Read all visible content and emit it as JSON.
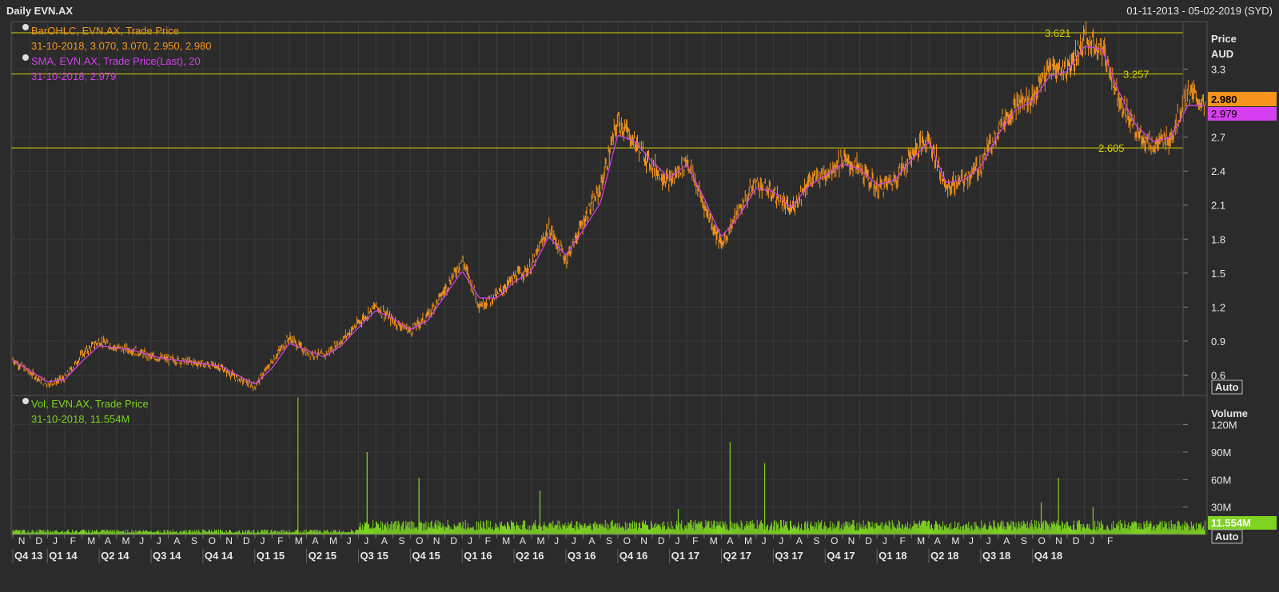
{
  "header": {
    "title": "Daily EVN.AX",
    "date_range": "01-11-2013 - 05-02-2019 (SYD)"
  },
  "colors": {
    "background": "#2b2b2b",
    "panel_border": "#555555",
    "grid": "#3b3b3b",
    "price_bars": "#f7941d",
    "sma": "#d63ff0",
    "volume": "#7ed321",
    "horizontal_lines": "#d4d400",
    "axis_text": "#e6e6e6"
  },
  "price_panel": {
    "legend": [
      {
        "icon": "radio-icon",
        "title": "BarOHLC, EVN.AX, Trade Price",
        "values": "31-10-2018, 3.070, 3.070, 2.950, 2.980"
      },
      {
        "icon": "radio-icon",
        "title": "SMA, EVN.AX, Trade Price(Last),  20",
        "values": "31-10-2018, 2.979"
      }
    ],
    "axis_title": "Price",
    "axis_unit": "AUD",
    "auto_label": "Auto",
    "last_price_tag": "2.980",
    "sma_tag": "2.979"
  },
  "volume_panel": {
    "legend": [
      {
        "icon": "radio-icon",
        "title": "Vol, EVN.AX, Trade Price",
        "values": "31-10-2018, 11.554M"
      }
    ],
    "axis_title": "Volume",
    "auto_label": "Auto",
    "last_volume_tag": "11.554M"
  },
  "chart_data": [
    {
      "type": "ohlc",
      "title": "Daily EVN.AX",
      "ylabel": "Price AUD",
      "ylim": [
        0.42,
        3.72
      ],
      "y_ticks": [
        "0.6",
        "0.9",
        "1.2",
        "1.5",
        "1.8",
        "2.1",
        "2.4",
        "2.7",
        "3.3"
      ],
      "y_tick_values": [
        0.6,
        0.9,
        1.2,
        1.5,
        1.8,
        2.1,
        2.4,
        2.7,
        3.3
      ],
      "x_range": [
        "2013-11",
        "2019-02"
      ],
      "horizontal_lines": [
        {
          "value": 3.621,
          "label": "3.621"
        },
        {
          "value": 3.257,
          "label": "3.257"
        },
        {
          "value": 2.605,
          "label": "2.605"
        }
      ],
      "series": [
        {
          "name": "BarOHLC, EVN.AX, Trade Price",
          "points": [
            [
              "2013-11",
              0.74
            ],
            [
              "2013-12",
              0.62
            ],
            [
              "2014-01",
              0.52
            ],
            [
              "2014-02",
              0.57
            ],
            [
              "2014-03",
              0.78
            ],
            [
              "2014-04",
              0.9
            ],
            [
              "2014-05",
              0.84
            ],
            [
              "2014-06",
              0.82
            ],
            [
              "2014-07",
              0.76
            ],
            [
              "2014-08",
              0.74
            ],
            [
              "2014-09",
              0.72
            ],
            [
              "2014-10",
              0.7
            ],
            [
              "2014-11",
              0.67
            ],
            [
              "2014-12",
              0.57
            ],
            [
              "2015-01",
              0.5
            ],
            [
              "2015-02",
              0.72
            ],
            [
              "2015-03",
              0.93
            ],
            [
              "2015-04",
              0.8
            ],
            [
              "2015-05",
              0.77
            ],
            [
              "2015-06",
              0.9
            ],
            [
              "2015-07",
              1.06
            ],
            [
              "2015-08",
              1.21
            ],
            [
              "2015-09",
              1.08
            ],
            [
              "2015-10",
              0.99
            ],
            [
              "2015-11",
              1.12
            ],
            [
              "2015-12",
              1.35
            ],
            [
              "2016-01",
              1.62
            ],
            [
              "2016-02",
              1.22
            ],
            [
              "2016-03",
              1.3
            ],
            [
              "2016-04",
              1.46
            ],
            [
              "2016-05",
              1.55
            ],
            [
              "2016-06",
              1.9
            ],
            [
              "2016-07",
              1.62
            ],
            [
              "2016-08",
              1.95
            ],
            [
              "2016-09",
              2.25
            ],
            [
              "2016-10",
              2.85
            ],
            [
              "2016-11",
              2.65
            ],
            [
              "2016-12",
              2.45
            ],
            [
              "2017-01",
              2.3
            ],
            [
              "2017-02",
              2.5
            ],
            [
              "2017-03",
              2.1
            ],
            [
              "2017-04",
              1.75
            ],
            [
              "2017-05",
              2.05
            ],
            [
              "2017-06",
              2.3
            ],
            [
              "2017-07",
              2.2
            ],
            [
              "2017-08",
              2.05
            ],
            [
              "2017-09",
              2.3
            ],
            [
              "2017-10",
              2.38
            ],
            [
              "2017-11",
              2.5
            ],
            [
              "2017-12",
              2.42
            ],
            [
              "2018-01",
              2.25
            ],
            [
              "2018-02",
              2.32
            ],
            [
              "2018-03",
              2.55
            ],
            [
              "2018-04",
              2.7
            ],
            [
              "2018-05",
              2.25
            ],
            [
              "2018-06",
              2.32
            ],
            [
              "2018-07",
              2.45
            ],
            [
              "2018-08",
              2.78
            ],
            [
              "2018-09",
              2.98
            ],
            [
              "2018-10",
              3.05
            ],
            [
              "2018-11",
              3.3
            ],
            [
              "2018-12",
              3.3
            ],
            [
              "2019-01",
              3.55
            ],
            [
              "2019-02",
              3.5
            ],
            [
              "2019-03",
              3.05
            ],
            [
              "2019-04",
              2.75
            ],
            [
              "2019-05",
              2.62
            ],
            [
              "2019-06",
              2.7
            ],
            [
              "2019-07",
              3.1
            ],
            [
              "2019-08",
              2.98
            ]
          ]
        },
        {
          "name": "SMA, EVN.AX, Trade Price(Last),  20",
          "points": [
            [
              "2013-11",
              0.73
            ],
            [
              "2013-12",
              0.64
            ],
            [
              "2014-01",
              0.54
            ],
            [
              "2014-02",
              0.56
            ],
            [
              "2014-03",
              0.72
            ],
            [
              "2014-04",
              0.86
            ],
            [
              "2014-05",
              0.84
            ],
            [
              "2014-06",
              0.82
            ],
            [
              "2014-07",
              0.77
            ],
            [
              "2014-08",
              0.74
            ],
            [
              "2014-09",
              0.72
            ],
            [
              "2014-10",
              0.7
            ],
            [
              "2014-11",
              0.68
            ],
            [
              "2014-12",
              0.6
            ],
            [
              "2015-01",
              0.52
            ],
            [
              "2015-02",
              0.66
            ],
            [
              "2015-03",
              0.88
            ],
            [
              "2015-04",
              0.82
            ],
            [
              "2015-05",
              0.76
            ],
            [
              "2015-06",
              0.86
            ],
            [
              "2015-07",
              1.02
            ],
            [
              "2015-08",
              1.17
            ],
            [
              "2015-09",
              1.1
            ],
            [
              "2015-10",
              1.0
            ],
            [
              "2015-11",
              1.08
            ],
            [
              "2015-12",
              1.3
            ],
            [
              "2016-01",
              1.52
            ],
            [
              "2016-02",
              1.28
            ],
            [
              "2016-03",
              1.28
            ],
            [
              "2016-04",
              1.42
            ],
            [
              "2016-05",
              1.52
            ],
            [
              "2016-06",
              1.82
            ],
            [
              "2016-07",
              1.66
            ],
            [
              "2016-08",
              1.88
            ],
            [
              "2016-09",
              2.12
            ],
            [
              "2016-10",
              2.72
            ],
            [
              "2016-11",
              2.66
            ],
            [
              "2016-12",
              2.48
            ],
            [
              "2017-01",
              2.34
            ],
            [
              "2017-02",
              2.46
            ],
            [
              "2017-03",
              2.16
            ],
            [
              "2017-04",
              1.82
            ],
            [
              "2017-05",
              2.0
            ],
            [
              "2017-06",
              2.25
            ],
            [
              "2017-07",
              2.22
            ],
            [
              "2017-08",
              2.08
            ],
            [
              "2017-09",
              2.26
            ],
            [
              "2017-10",
              2.36
            ],
            [
              "2017-11",
              2.46
            ],
            [
              "2017-12",
              2.42
            ],
            [
              "2018-01",
              2.28
            ],
            [
              "2018-02",
              2.32
            ],
            [
              "2018-03",
              2.5
            ],
            [
              "2018-04",
              2.66
            ],
            [
              "2018-05",
              2.3
            ],
            [
              "2018-06",
              2.32
            ],
            [
              "2018-07",
              2.44
            ],
            [
              "2018-08",
              2.72
            ],
            [
              "2018-09",
              2.94
            ],
            [
              "2018-10",
              3.02
            ],
            [
              "2018-11",
              3.24
            ],
            [
              "2018-12",
              3.28
            ],
            [
              "2019-01",
              3.5
            ],
            [
              "2019-02",
              3.48
            ],
            [
              "2019-03",
              3.1
            ],
            [
              "2019-04",
              2.8
            ],
            [
              "2019-05",
              2.66
            ],
            [
              "2019-06",
              2.7
            ],
            [
              "2019-07",
              2.98
            ],
            [
              "2019-08",
              2.979
            ]
          ]
        }
      ]
    },
    {
      "type": "bar",
      "title": "Volume",
      "ylabel": "Volume",
      "ylim": [
        0,
        145
      ],
      "y_ticks": [
        "30M",
        "60M",
        "90M",
        "120M"
      ],
      "y_tick_values": [
        30,
        60,
        90,
        120
      ],
      "series": [
        {
          "name": "Vol, EVN.AX, Trade Price",
          "unit": "M",
          "baseline_low": 4,
          "baseline_high": 16,
          "spikes": [
            [
              "2015-03",
              150
            ],
            [
              "2015-07",
              90
            ],
            [
              "2015-10",
              62
            ],
            [
              "2015-10",
              58
            ],
            [
              "2016-05",
              48
            ],
            [
              "2017-01",
              28
            ],
            [
              "2017-04",
              101
            ],
            [
              "2017-06",
              78
            ],
            [
              "2018-11",
              62
            ],
            [
              "2018-10",
              35
            ],
            [
              "2019-01",
              30
            ]
          ],
          "last_value": 11.554
        }
      ]
    }
  ],
  "x_axis": {
    "months": [
      "N",
      "D",
      "J",
      "F",
      "M",
      "A",
      "M",
      "J",
      "J",
      "A",
      "S",
      "O",
      "N",
      "D",
      "J",
      "F",
      "M",
      "A",
      "M",
      "J",
      "J",
      "A",
      "S",
      "O",
      "N",
      "D",
      "J",
      "F",
      "M",
      "A",
      "M",
      "J",
      "J",
      "A",
      "S",
      "O",
      "N",
      "D",
      "J",
      "F",
      "M",
      "A",
      "M",
      "J",
      "J",
      "A",
      "S",
      "O",
      "N",
      "D",
      "J",
      "F",
      "M",
      "A",
      "M",
      "J",
      "J",
      "A",
      "S",
      "O",
      "N",
      "D",
      "J",
      "F"
    ],
    "quarters": [
      "Q4 13",
      "Q1 14",
      "Q2 14",
      "Q3 14",
      "Q4 14",
      "Q1 15",
      "Q2 15",
      "Q3 15",
      "Q4 15",
      "Q1 16",
      "Q2 16",
      "Q3 16",
      "Q4 16",
      "Q1 17",
      "Q2 17",
      "Q3 17",
      "Q4 17",
      "Q1 18",
      "Q2 18",
      "Q3 18",
      "Q4 18"
    ]
  }
}
